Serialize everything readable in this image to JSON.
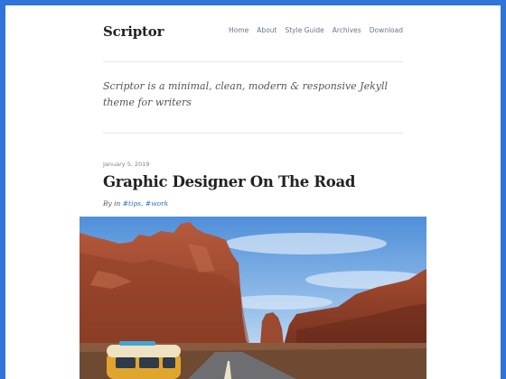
{
  "site": {
    "title": "Scriptor"
  },
  "nav": {
    "items": [
      {
        "label": "Home"
      },
      {
        "label": "About"
      },
      {
        "label": "Style Guide"
      },
      {
        "label": "Archives"
      },
      {
        "label": "Download"
      }
    ]
  },
  "tagline": "Scriptor is a minimal, clean, modern & responsive Jekyll theme for writers",
  "post": {
    "date": "January 5, 2019",
    "title": "Graphic Designer On The Road",
    "by_in": "By in",
    "tags": [
      {
        "label": "#tips"
      },
      {
        "label": "#work"
      }
    ],
    "tag_separator": ", "
  },
  "colors": {
    "frame": "#2f74d8",
    "link": "#2a6fd6",
    "text": "#222222",
    "muted": "#6b7686"
  }
}
